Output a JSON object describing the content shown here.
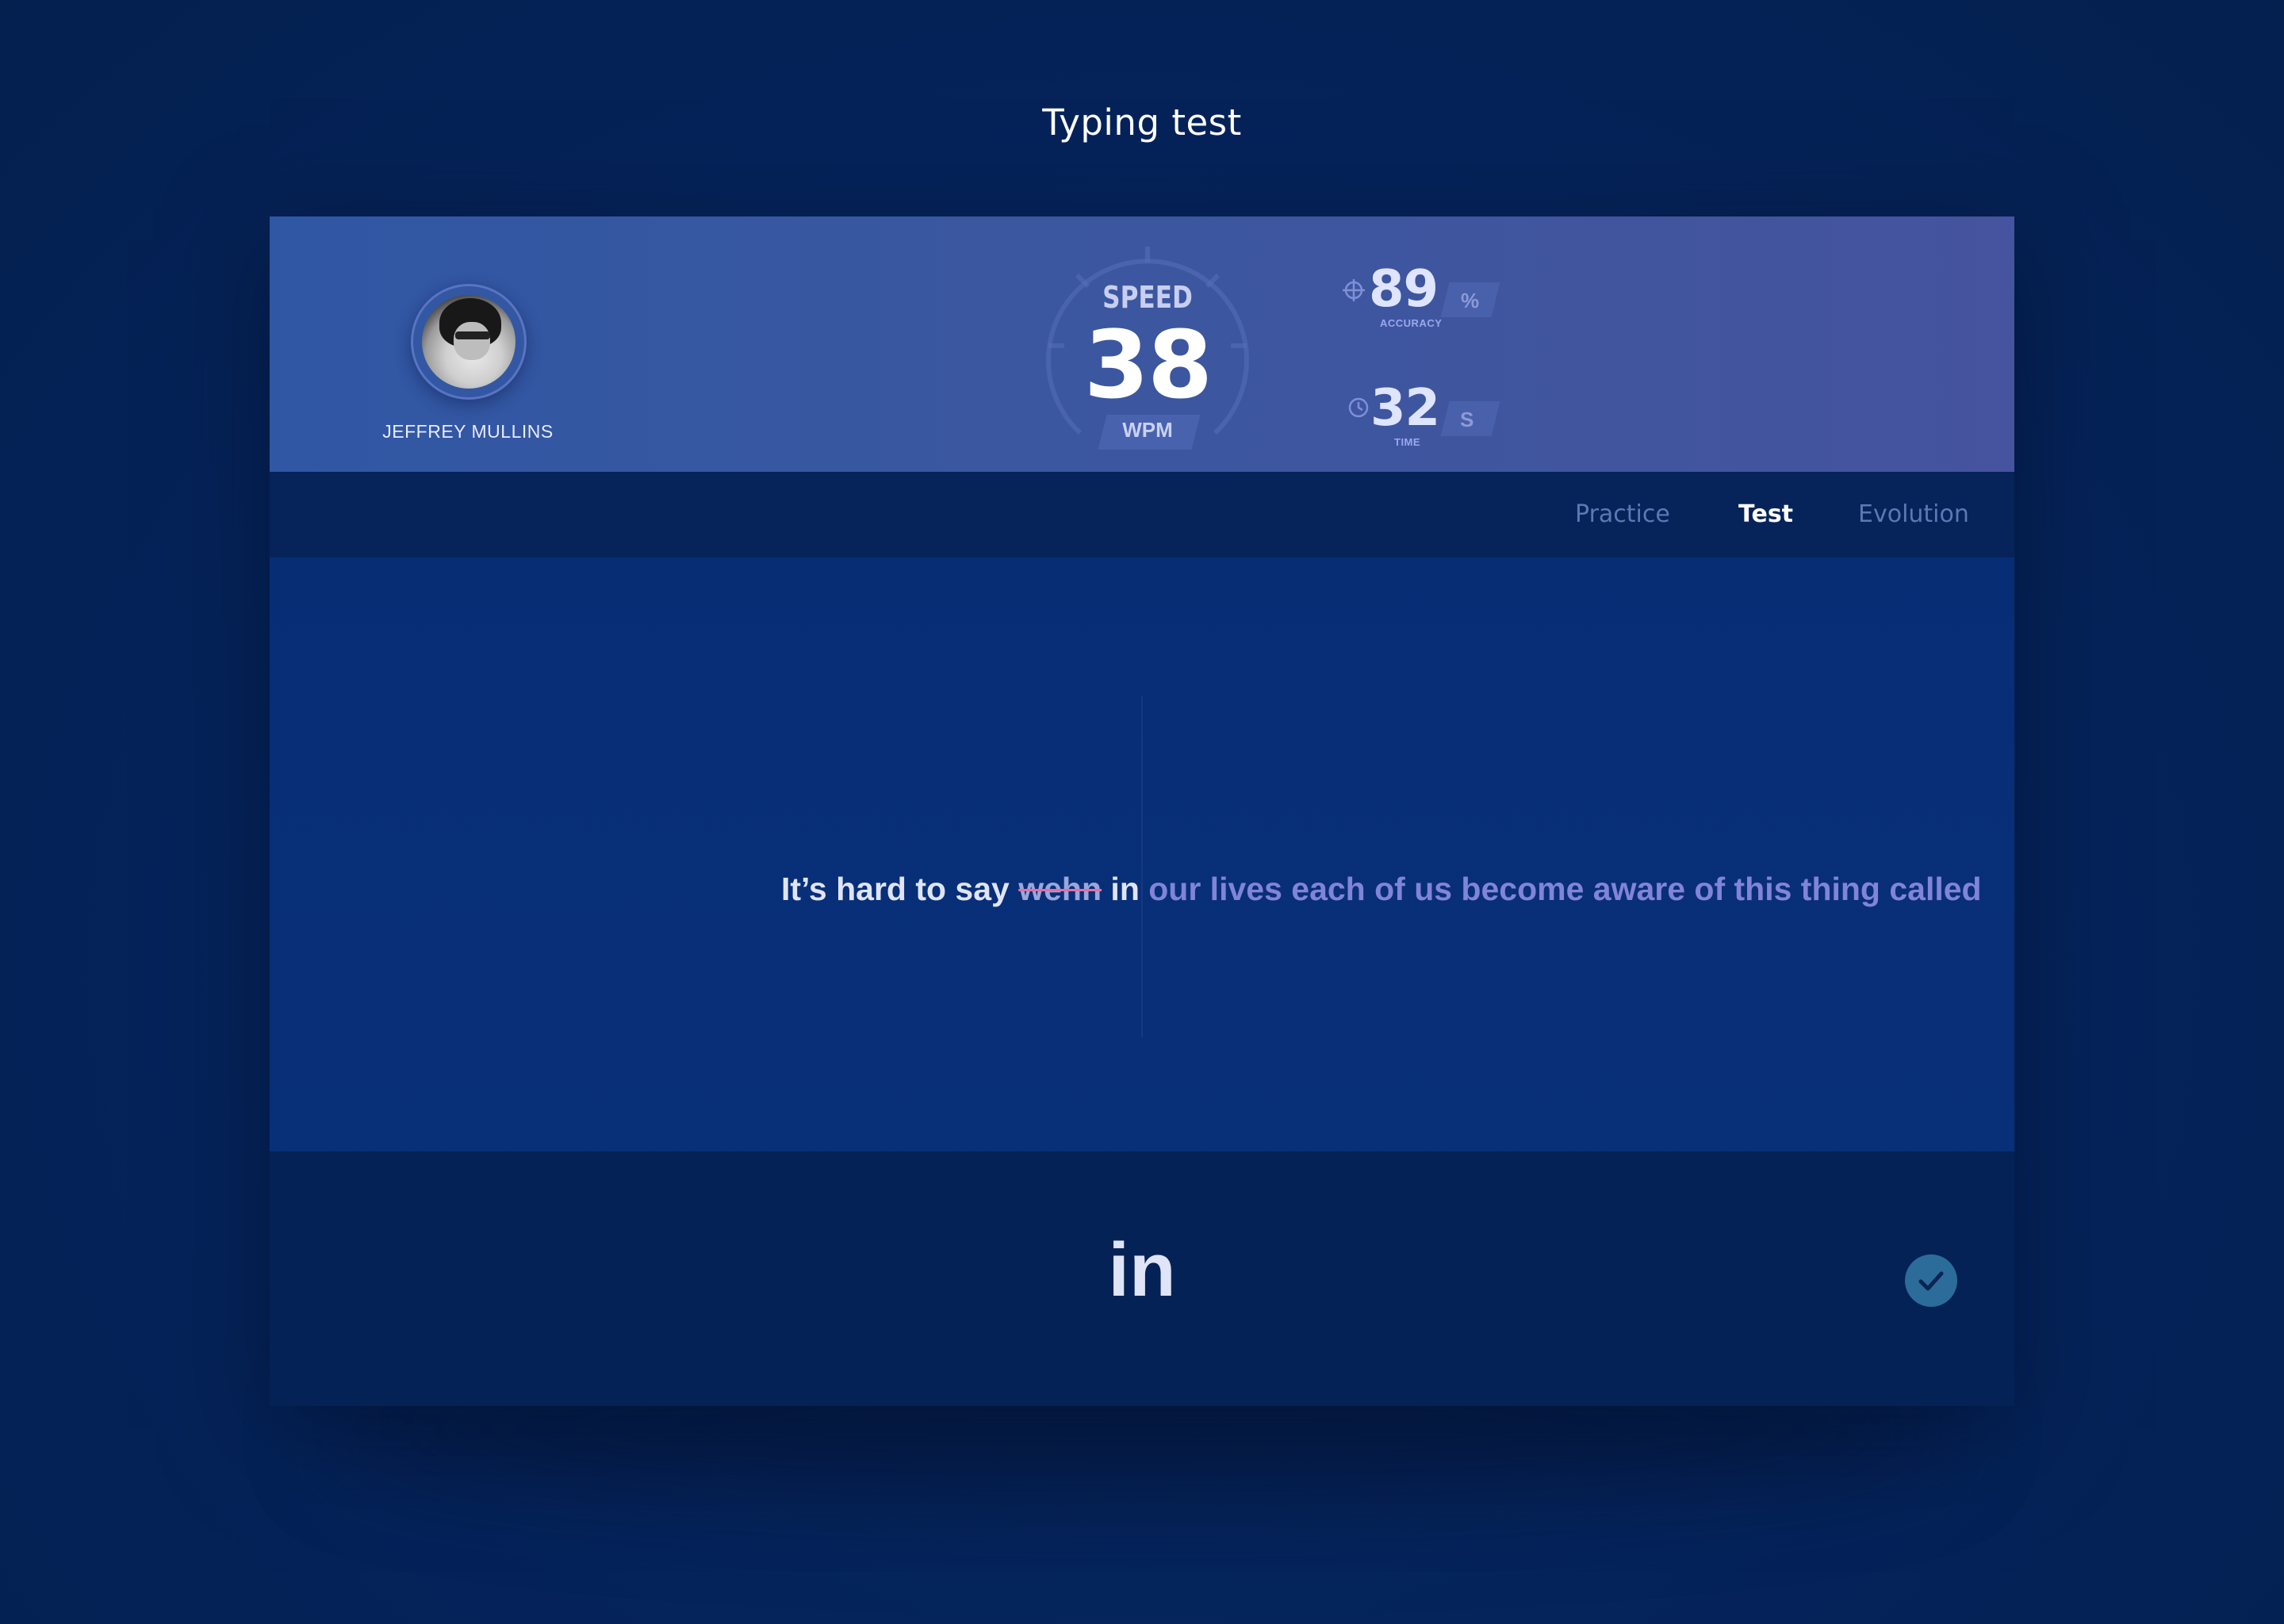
{
  "page": {
    "title": "Typing test"
  },
  "header": {
    "user_name": "JEFFREY MULLINS",
    "speed": {
      "label": "SPEED",
      "value": "38",
      "unit": "WPM"
    },
    "accuracy": {
      "value": "89",
      "unit": "%",
      "caption": "ACCURACY"
    },
    "time": {
      "value": "32",
      "unit": "S",
      "caption": "TIME"
    }
  },
  "tabs": [
    {
      "label": "Practice",
      "active": false
    },
    {
      "label": "Test",
      "active": true
    },
    {
      "label": "Evolution",
      "active": false
    }
  ],
  "typing": {
    "typed_text": "It’s hard to say ",
    "error_word": "wehn",
    "current_typed": " in ",
    "remaining_text": "our lives each of us become aware of this thing called",
    "progress_fraction": 0.373
  },
  "input": {
    "current_word": "in"
  },
  "colors": {
    "background": "#05245b",
    "header_start": "#3057a4",
    "header_end": "#46539f",
    "error_underline": "#e46fa6",
    "remaining_text": "#8184d8",
    "check_button": "#2c6c9a"
  },
  "icons": {
    "accuracy": "crosshair-icon",
    "time": "clock-icon",
    "submit": "checkmark-icon"
  }
}
